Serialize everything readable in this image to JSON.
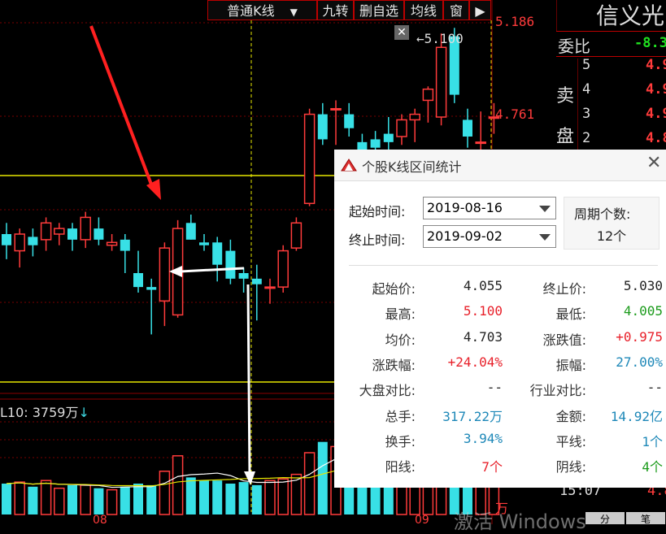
{
  "toolbar": {
    "chart_type": "普通K线",
    "nine_turn": "九转",
    "del_watch": "删自选",
    "ma_line": "均线",
    "window": "窗"
  },
  "price_axis": {
    "top": "5.186",
    "mid": "4.761",
    "peak_label": "5.100"
  },
  "volume_panel": {
    "ma_label": "L10: 3759万",
    "ma_arrow": "↓",
    "month_1": "08",
    "month_2": "09",
    "bottom_right": "万"
  },
  "right_panel": {
    "stock_name": "信义光",
    "commission_ratio_label": "委比",
    "commission_ratio_value": "-8.3",
    "sell_label_1": "卖",
    "sell_label_2": "盘",
    "levels": [
      {
        "n": "5",
        "price": "4.9"
      },
      {
        "n": "4",
        "price": "4.9"
      },
      {
        "n": "3",
        "price": "4.9"
      },
      {
        "n": "2",
        "price": "4.8"
      }
    ],
    "time": "15:07",
    "time_price": "4.8",
    "tab_1": "分",
    "tab_2": "笔"
  },
  "watermark": "激活 Windows",
  "dialog": {
    "title": "个股K线区间统计",
    "start_label": "起始时间:",
    "start_value": "2019-08-16",
    "end_label": "终止时间:",
    "end_value": "2019-09-02",
    "period_label": "周期个数:",
    "period_value": "12个",
    "stats": [
      {
        "l1": "起始价:",
        "v1": "4.055",
        "c1": "black",
        "l2": "终止价:",
        "v2": "5.030",
        "c2": "black"
      },
      {
        "l1": "最高:",
        "v1": "5.100",
        "c1": "red",
        "l2": "最低:",
        "v2": "4.005",
        "c2": "green"
      },
      {
        "l1": "均价:",
        "v1": "4.703",
        "c1": "black",
        "l2": "涨跌值:",
        "v2": "+0.975",
        "c2": "red"
      },
      {
        "l1": "涨跌幅:",
        "v1": "+24.04%",
        "c1": "red",
        "l2": "振幅:",
        "v2": "27.00%",
        "c2": "blue"
      },
      {
        "l1": "大盘对比:",
        "v1": "--",
        "c1": "black",
        "l2": "行业对比:",
        "v2": "--",
        "c2": "black"
      },
      {
        "l1": "总手:",
        "v1": "317.22万",
        "c1": "blue",
        "l2": "金额:",
        "v2": "14.92亿",
        "c2": "blue"
      },
      {
        "l1": "换手:",
        "v1": "3.94%",
        "c1": "blue",
        "l2": "平线:",
        "v2": "1个",
        "c2": "blue"
      },
      {
        "l1": "阳线:",
        "v1": "7个",
        "c1": "red",
        "l2": "阴线:",
        "v2": "4个",
        "c2": "green"
      }
    ]
  },
  "chart_data": {
    "type": "candlestick",
    "ylim": [
      3.8,
      5.2
    ],
    "candles": [
      {
        "o": 4.36,
        "h": 4.4,
        "l": 4.27,
        "c": 4.32
      },
      {
        "o": 4.3,
        "h": 4.38,
        "l": 4.24,
        "c": 4.36
      },
      {
        "o": 4.35,
        "h": 4.38,
        "l": 4.28,
        "c": 4.32
      },
      {
        "o": 4.34,
        "h": 4.42,
        "l": 4.3,
        "c": 4.4
      },
      {
        "o": 4.36,
        "h": 4.4,
        "l": 4.32,
        "c": 4.38
      },
      {
        "o": 4.38,
        "h": 4.4,
        "l": 4.3,
        "c": 4.34
      },
      {
        "o": 4.34,
        "h": 4.44,
        "l": 4.31,
        "c": 4.42
      },
      {
        "o": 4.38,
        "h": 4.42,
        "l": 4.32,
        "c": 4.34
      },
      {
        "o": 4.32,
        "h": 4.36,
        "l": 4.3,
        "c": 4.33
      },
      {
        "o": 4.34,
        "h": 4.36,
        "l": 4.22,
        "c": 4.3
      },
      {
        "o": 4.22,
        "h": 4.3,
        "l": 4.15,
        "c": 4.17
      },
      {
        "o": 4.17,
        "h": 4.2,
        "l": 4.0,
        "c": 4.16
      },
      {
        "o": 4.12,
        "h": 4.33,
        "l": 4.03,
        "c": 4.31
      },
      {
        "o": 4.07,
        "h": 4.41,
        "l": 4.06,
        "c": 4.38
      },
      {
        "o": 4.4,
        "h": 4.43,
        "l": 4.34,
        "c": 4.34
      },
      {
        "o": 4.33,
        "h": 4.36,
        "l": 4.3,
        "c": 4.32
      },
      {
        "o": 4.33,
        "h": 4.35,
        "l": 4.19,
        "c": 4.25
      },
      {
        "o": 4.3,
        "h": 4.34,
        "l": 4.18,
        "c": 4.2
      },
      {
        "o": 4.22,
        "h": 4.24,
        "l": 4.15,
        "c": 4.2
      },
      {
        "o": 4.2,
        "h": 4.25,
        "l": 4.05,
        "c": 4.18
      },
      {
        "o": 4.17,
        "h": 4.2,
        "l": 4.11,
        "c": 4.17
      },
      {
        "o": 4.17,
        "h": 4.32,
        "l": 4.15,
        "c": 4.3
      },
      {
        "o": 4.31,
        "h": 4.42,
        "l": 4.3,
        "c": 4.4
      },
      {
        "o": 4.47,
        "h": 4.81,
        "l": 4.46,
        "c": 4.79
      },
      {
        "o": 4.79,
        "h": 4.83,
        "l": 4.68,
        "c": 4.7
      },
      {
        "o": 4.81,
        "h": 4.84,
        "l": 4.68,
        "c": 4.81
      },
      {
        "o": 4.79,
        "h": 4.83,
        "l": 4.71,
        "c": 4.74
      },
      {
        "o": 4.69,
        "h": 4.72,
        "l": 4.62,
        "c": 4.66
      },
      {
        "o": 4.7,
        "h": 4.73,
        "l": 4.62,
        "c": 4.67
      },
      {
        "o": 4.72,
        "h": 4.78,
        "l": 4.66,
        "c": 4.69
      },
      {
        "o": 4.71,
        "h": 4.79,
        "l": 4.68,
        "c": 4.77
      },
      {
        "o": 4.77,
        "h": 4.81,
        "l": 4.69,
        "c": 4.79
      },
      {
        "o": 4.84,
        "h": 4.89,
        "l": 4.76,
        "c": 4.88
      },
      {
        "o": 4.78,
        "h": 5.08,
        "l": 4.75,
        "c": 5.03
      },
      {
        "o": 5.07,
        "h": 5.1,
        "l": 4.83,
        "c": 4.86
      },
      {
        "o": 4.77,
        "h": 4.81,
        "l": 4.67,
        "c": 4.71
      },
      {
        "o": 4.69,
        "h": 4.8,
        "l": 4.63,
        "c": 4.69
      },
      {
        "o": 4.78,
        "h": 4.83,
        "l": 4.72,
        "c": 4.78
      }
    ],
    "volume": [
      20,
      21,
      18,
      22,
      17,
      19,
      19,
      17,
      16,
      18,
      20,
      19,
      28,
      38,
      24,
      22,
      22,
      20,
      21,
      19,
      22,
      23,
      26,
      40,
      47,
      44,
      40,
      40,
      38,
      37,
      36,
      37,
      35,
      52,
      55,
      46,
      40,
      40
    ]
  }
}
